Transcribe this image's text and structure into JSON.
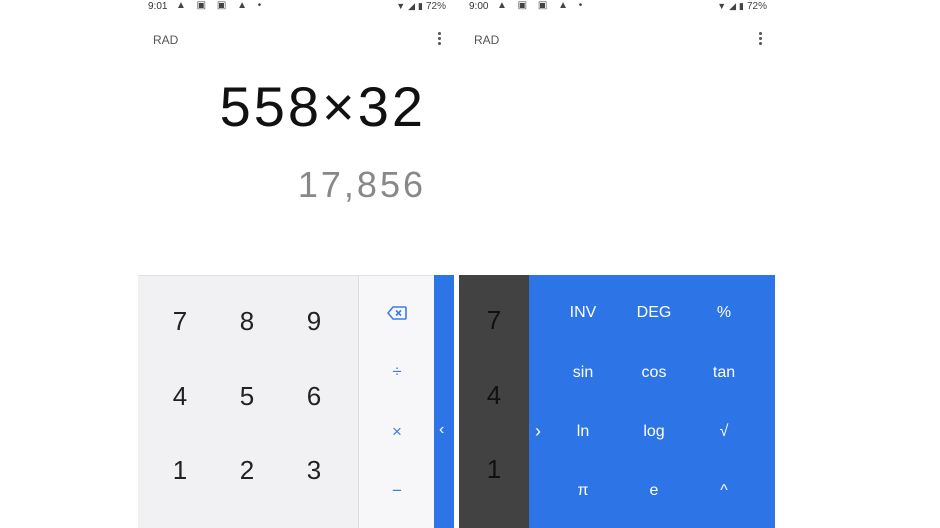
{
  "left_screen": {
    "status": {
      "time": "9:01",
      "battery": "72%"
    },
    "mode": "RAD",
    "formula": "558×32",
    "result": "17,856",
    "keys": [
      "7",
      "8",
      "9",
      "4",
      "5",
      "6",
      "1",
      "2",
      "3"
    ],
    "ops": [
      "÷",
      "×",
      "−"
    ],
    "adv_toggle": "‹"
  },
  "right_screen": {
    "status": {
      "time": "9:00",
      "battery": "72%"
    },
    "mode": "RAD",
    "keys": [
      "7",
      "4",
      "1"
    ],
    "collapse_toggle": "›",
    "functions": [
      "INV",
      "DEG",
      "%",
      "sin",
      "cos",
      "tan",
      "ln",
      "log",
      "√",
      "π",
      "e",
      "^"
    ]
  },
  "colors": {
    "accent": "#2d74e6",
    "numpad_bg": "#f1f1f3",
    "dark_numpad": "#424242"
  },
  "icons": [
    "wifi-icon",
    "signal-icon",
    "battery-icon",
    "more-vert-icon",
    "backspace-icon",
    "chevron-left-icon",
    "chevron-right-icon"
  ]
}
